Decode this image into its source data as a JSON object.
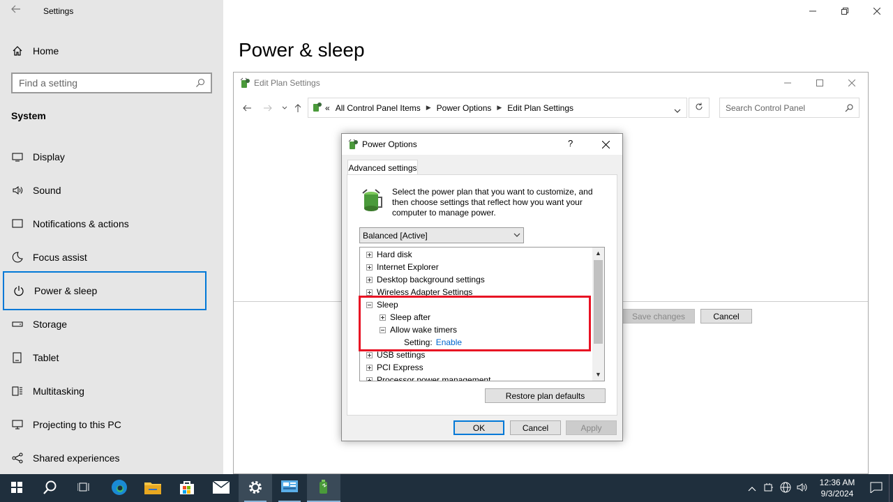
{
  "settings": {
    "app_title": "Settings",
    "page_title": "Power & sleep",
    "home_label": "Home",
    "search_placeholder": "Find a setting",
    "section_label": "System",
    "nav": [
      {
        "label": "Display",
        "icon": "display-icon"
      },
      {
        "label": "Sound",
        "icon": "sound-icon"
      },
      {
        "label": "Notifications & actions",
        "icon": "notifications-icon"
      },
      {
        "label": "Focus assist",
        "icon": "moon-icon"
      },
      {
        "label": "Power & sleep",
        "icon": "power-icon"
      },
      {
        "label": "Storage",
        "icon": "storage-icon"
      },
      {
        "label": "Tablet",
        "icon": "tablet-icon"
      },
      {
        "label": "Multitasking",
        "icon": "multitasking-icon"
      },
      {
        "label": "Projecting to this PC",
        "icon": "projecting-icon"
      },
      {
        "label": "Shared experiences",
        "icon": "shared-experiences-icon"
      }
    ],
    "selected_nav": "Power & sleep"
  },
  "control_panel": {
    "window_title": "Edit Plan Settings",
    "breadcrumb_prefix": "«",
    "breadcrumbs": [
      "All Control Panel Items",
      "Power Options",
      "Edit Plan Settings"
    ],
    "search_placeholder": "Search Control Panel",
    "save_label": "Save changes",
    "cancel_label": "Cancel"
  },
  "dialog": {
    "title": "Power Options",
    "help_label": "?",
    "tab_label": "Advanced settings",
    "intro_text": "Select the power plan that you want to customize, and then choose settings that reflect how you want your computer to manage power.",
    "plan_selected": "Balanced [Active]",
    "tree": [
      {
        "label": "Hard disk",
        "expanded": false,
        "level": 0
      },
      {
        "label": "Internet Explorer",
        "expanded": false,
        "level": 0
      },
      {
        "label": "Desktop background settings",
        "expanded": false,
        "level": 0
      },
      {
        "label": "Wireless Adapter Settings",
        "expanded": false,
        "level": 0
      },
      {
        "label": "Sleep",
        "expanded": true,
        "level": 0
      },
      {
        "label": "Sleep after",
        "expanded": false,
        "level": 1
      },
      {
        "label": "Allow wake timers",
        "expanded": true,
        "level": 1
      },
      {
        "label": "Setting:",
        "value": "Enable",
        "level": 2
      },
      {
        "label": "USB settings",
        "expanded": false,
        "level": 0
      },
      {
        "label": "PCI Express",
        "expanded": false,
        "level": 0
      },
      {
        "label": "Processor power management",
        "expanded": false,
        "level": 0
      }
    ],
    "restore_label": "Restore plan defaults",
    "ok_label": "OK",
    "cancel_label": "Cancel",
    "apply_label": "Apply"
  },
  "taskbar": {
    "time": "12:36 AM",
    "date": "9/3/2024"
  },
  "colors": {
    "accent": "#0078d7",
    "highlight": "#e81123",
    "taskbar": "#1f2f3d",
    "sidebar": "#e6e6e6",
    "link": "#0066cc"
  }
}
